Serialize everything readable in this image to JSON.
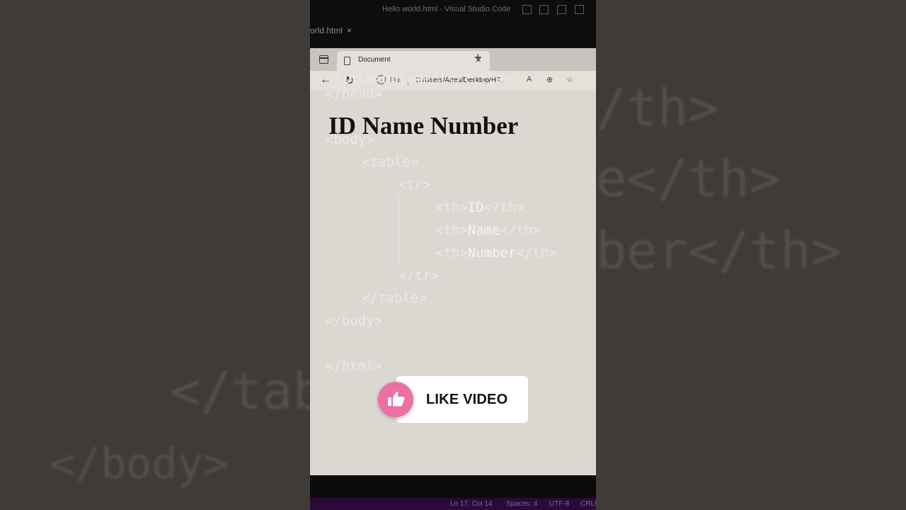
{
  "vscode": {
    "window_title": "Hello world.html - Visual Studio Code",
    "tab_label": "orld.html",
    "tab_close": "×",
    "status": {
      "position": "Ln 17, Col 14",
      "spaces": "Spaces: 4",
      "encoding": "UTF-8",
      "eol": "CRLF"
    }
  },
  "browser": {
    "tab_title": "Document",
    "tab_close": "×",
    "new_tab": "+",
    "address_info": "i",
    "address_scheme": "File",
    "address_url": "C:/Users/Aries/Desktop/HT...",
    "read_aloud": "A",
    "zoom": "⊕",
    "favorite": "☆"
  },
  "page": {
    "heading": "ID Name Number"
  },
  "code_lines": {
    "l1": "<title>Document</title>",
    "l2": "</head>",
    "l3": "<body>",
    "l4": "<table>",
    "l5": "<tr>",
    "l6a": "<th>",
    "l6b": "ID",
    "l6c": "</th>",
    "l7a": "<th>",
    "l7b": "Name",
    "l7c": "</th>",
    "l8a": "<th>",
    "l8b": "Number",
    "l8c": "</th>",
    "l9": "</tr>",
    "l10": "</table>",
    "l11": "</body>",
    "l12": "</html>"
  },
  "background_code": {
    "left1": "</tab",
    "left2": "</body>",
    "right1": "/th>",
    "right2": "e</th>",
    "right3": "ber</th>"
  },
  "overlay": {
    "like_label": "LIKE VIDEO"
  },
  "colors": {
    "like_circle": "#ec6fa5",
    "status_bar": "#2a0a38"
  }
}
